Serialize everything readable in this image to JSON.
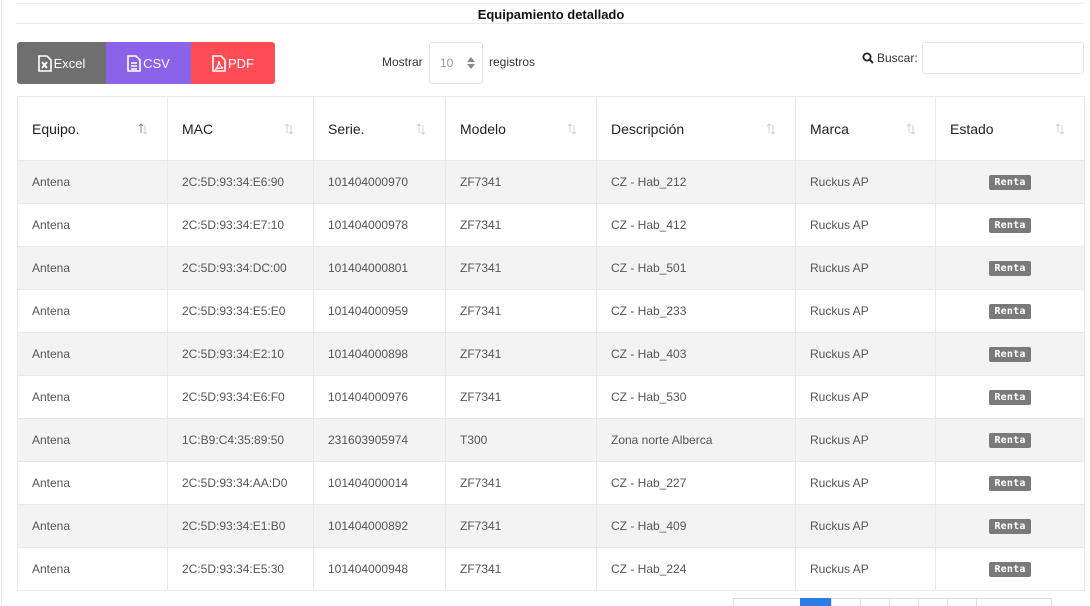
{
  "header": {
    "title": "Equipamiento detallado"
  },
  "toolbar": {
    "export_buttons": [
      {
        "label": "Excel",
        "icon": "file-excel-icon",
        "color": "#6f6f6f"
      },
      {
        "label": "CSV",
        "icon": "file-csv-icon",
        "color": "#8a63e8"
      },
      {
        "label": "PDF",
        "icon": "file-pdf-icon",
        "color": "#ff4d55"
      }
    ],
    "length": {
      "prefix": "Mostrar",
      "value": "10",
      "suffix": "registros"
    },
    "search": {
      "label": "Buscar:",
      "value": "",
      "icon": "search-icon"
    }
  },
  "table": {
    "columns": [
      "Equipo.",
      "MAC",
      "Serie.",
      "Modelo",
      "Descripción",
      "Marca",
      "Estado"
    ],
    "rows": [
      [
        "Antena",
        "2C:5D:93:34:E6:90",
        "101404000970",
        "ZF7341",
        "CZ - Hab_212",
        "Ruckus AP",
        "Renta"
      ],
      [
        "Antena",
        "2C:5D:93:34:E7:10",
        "101404000978",
        "ZF7341",
        "CZ - Hab_412",
        "Ruckus AP",
        "Renta"
      ],
      [
        "Antena",
        "2C:5D:93:34:DC:00",
        "101404000801",
        "ZF7341",
        "CZ - Hab_501",
        "Ruckus AP",
        "Renta"
      ],
      [
        "Antena",
        "2C:5D:93:34:E5:E0",
        "101404000959",
        "ZF7341",
        "CZ - Hab_233",
        "Ruckus AP",
        "Renta"
      ],
      [
        "Antena",
        "2C:5D:93:34:E2:10",
        "101404000898",
        "ZF7341",
        "CZ - Hab_403",
        "Ruckus AP",
        "Renta"
      ],
      [
        "Antena",
        "2C:5D:93:34:E6:F0",
        "101404000976",
        "ZF7341",
        "CZ - Hab_530",
        "Ruckus AP",
        "Renta"
      ],
      [
        "Antena",
        "1C:B9:C4:35:89:50",
        "231603905974",
        "T300",
        "Zona norte Alberca",
        "Ruckus AP",
        "Renta"
      ],
      [
        "Antena",
        "2C:5D:93:34:AA:D0",
        "101404000014",
        "ZF7341",
        "CZ - Hab_227",
        "Ruckus AP",
        "Renta"
      ],
      [
        "Antena",
        "2C:5D:93:34:E1:B0",
        "101404000892",
        "ZF7341",
        "CZ - Hab_409",
        "Ruckus AP",
        "Renta"
      ],
      [
        "Antena",
        "2C:5D:93:34:E5:30",
        "101404000948",
        "ZF7341",
        "CZ - Hab_224",
        "Ruckus AP",
        "Renta"
      ]
    ]
  },
  "colors": {
    "badge": "#7a7a7a",
    "pager_active": "#2d7be5"
  }
}
